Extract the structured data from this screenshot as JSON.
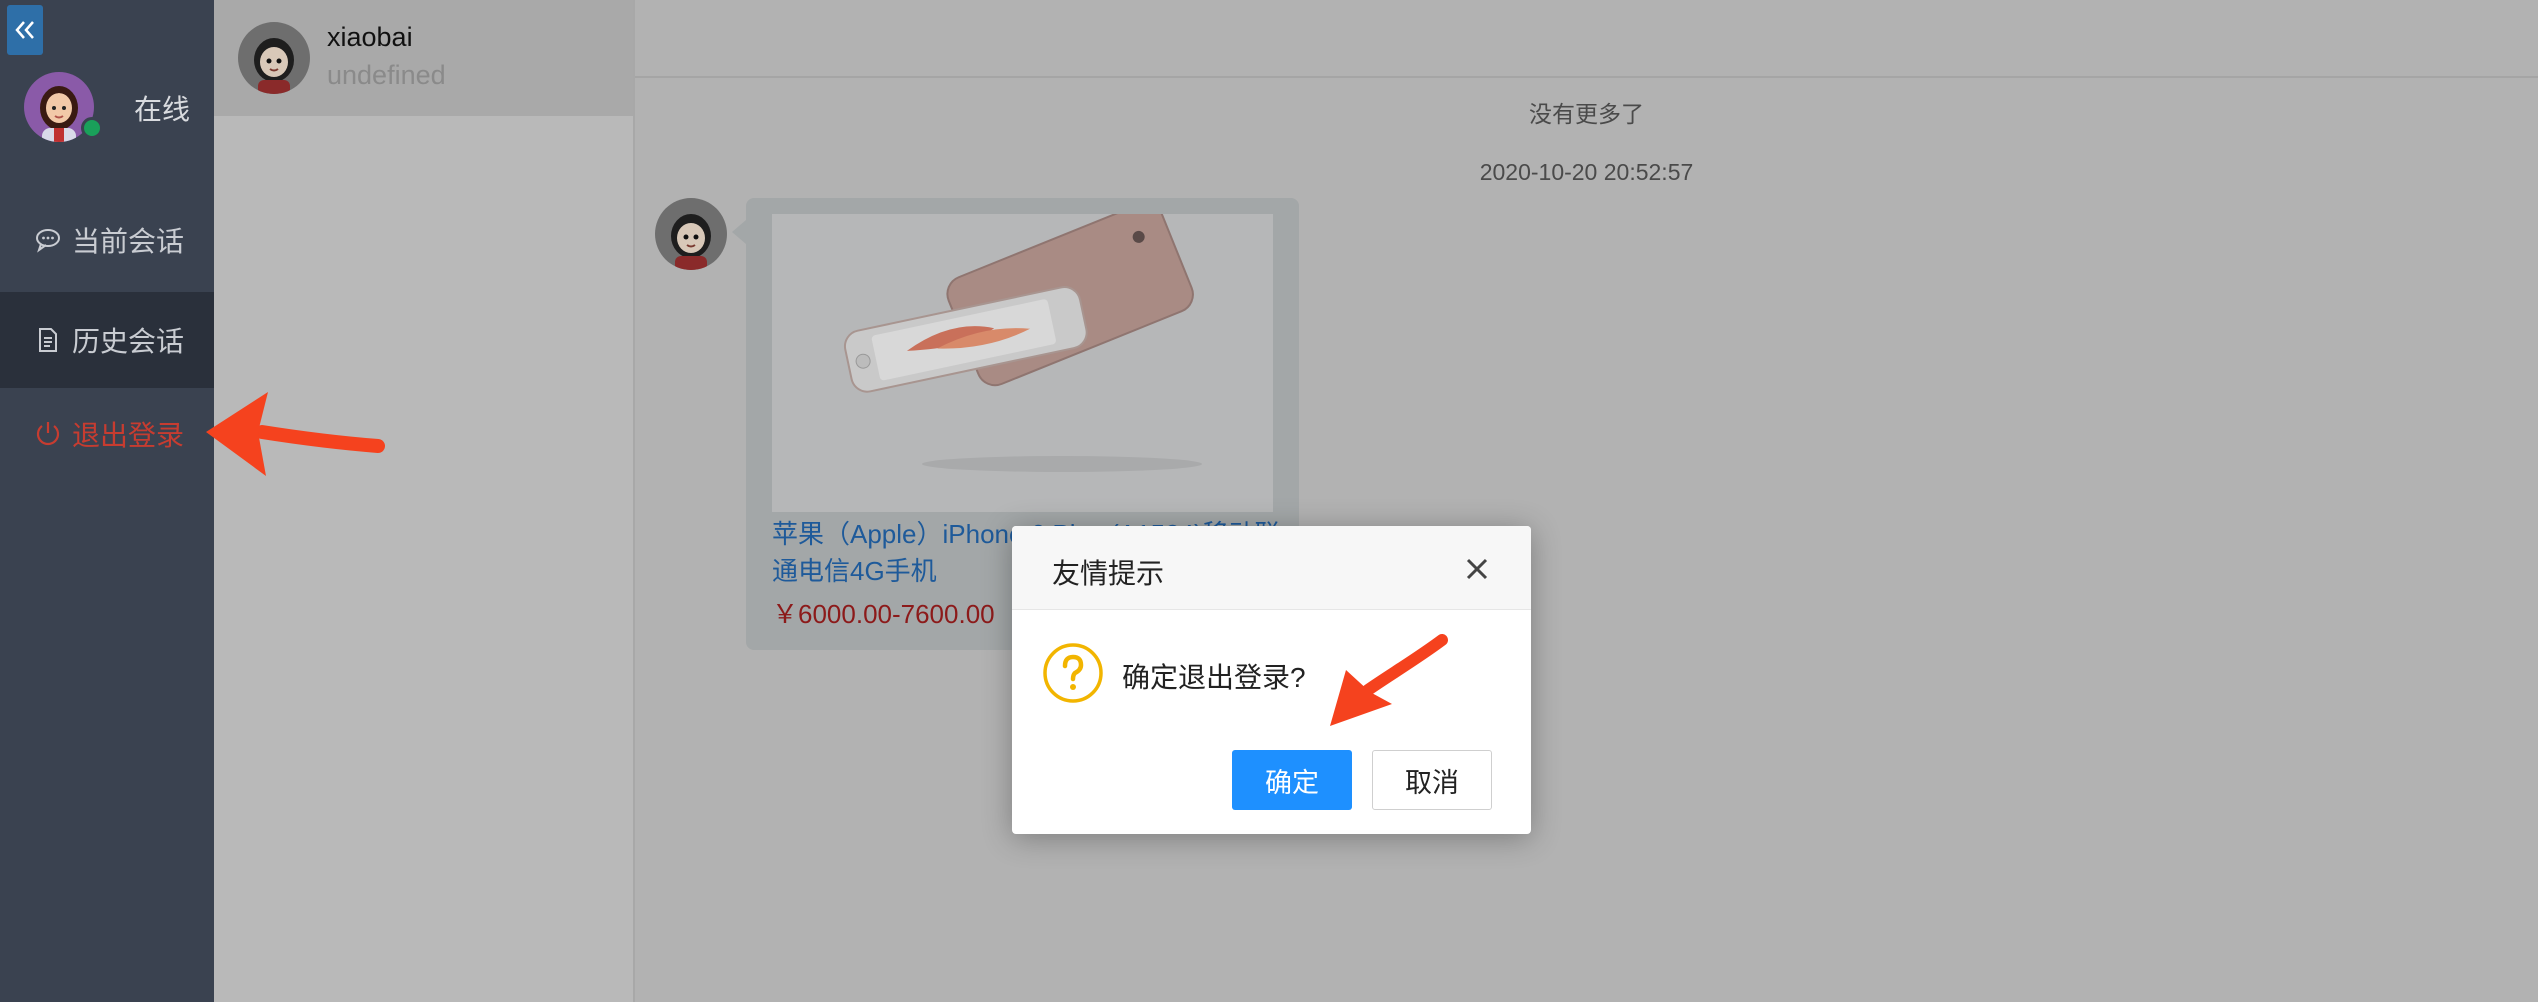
{
  "sidebar": {
    "collapse_icon": "double-chevron-left",
    "status": "在线",
    "menu": [
      {
        "label": "当前会话",
        "icon": "chat-bubble-icon"
      },
      {
        "label": "历史会话",
        "icon": "document-icon"
      },
      {
        "label": "退出登录",
        "icon": "power-icon"
      }
    ]
  },
  "conversation": {
    "name": "xiaobai",
    "subtitle": "undefined"
  },
  "chat": {
    "no_more": "没有更多了",
    "timestamp": "2020-10-20 20:52:57",
    "product": {
      "title": "苹果（Apple）iPhone 6 Plus (A1524)移动联通电信4G手机",
      "price": "￥6000.00-7600.00"
    }
  },
  "modal": {
    "title": "友情提示",
    "message": "确定退出登录?",
    "confirm_label": "确定",
    "cancel_label": "取消"
  },
  "colors": {
    "sidebar_bg": "#3a4250",
    "logout_text": "#c73c30",
    "confirm_button": "#1e90ff",
    "annotation_arrow": "#f5421e",
    "warning_icon": "#f2b500"
  }
}
